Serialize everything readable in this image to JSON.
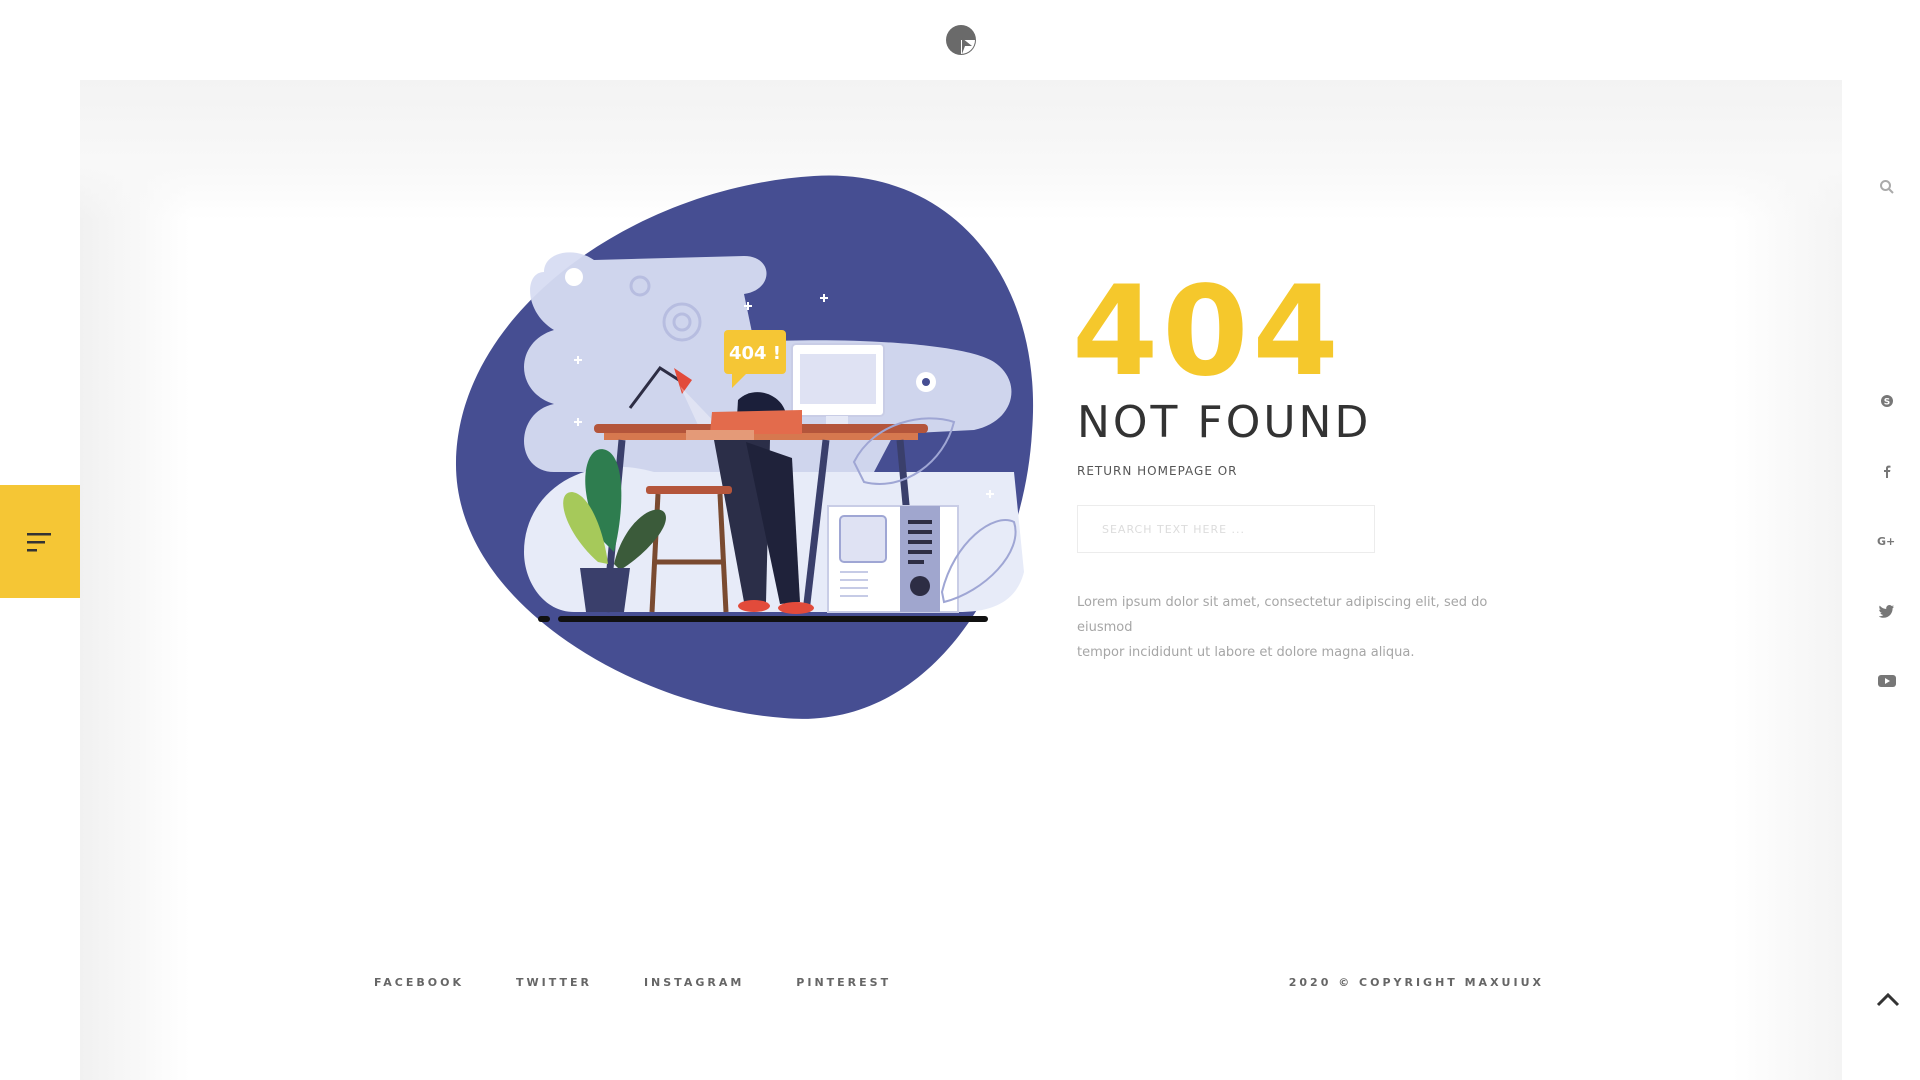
{
  "brand": {
    "accent": "#f5c635",
    "blob_color": "#464e92",
    "text_dark": "#333333"
  },
  "header": {
    "logo_icon": "logo-icon"
  },
  "left_rail": {
    "menu_icon": "hamburger-menu-icon"
  },
  "right_rail": {
    "icons": [
      "search-icon",
      "skype-icon",
      "facebook-icon",
      "google-plus-icon",
      "twitter-icon",
      "youtube-icon"
    ],
    "back_to_top_icon": "chevron-up-icon"
  },
  "main": {
    "illustration_badge": "404 !",
    "error_code": "404",
    "error_title": "NOT FOUND",
    "return_label": "RETURN HOMEPAGE OR",
    "search": {
      "placeholder": "SEARCH TEXT HERE ...",
      "value": ""
    },
    "description_line1": "Lorem ipsum dolor sit amet, consectetur adipiscing elit, sed do eiusmod",
    "description_line2": "tempor incididunt ut labore et dolore magna aliqua."
  },
  "footer": {
    "social_links": [
      "FACEBOOK",
      "TWITTER",
      "INSTAGRAM",
      "PINTEREST"
    ],
    "copyright": "2020 © COPYRIGHT MAXUIUX"
  }
}
